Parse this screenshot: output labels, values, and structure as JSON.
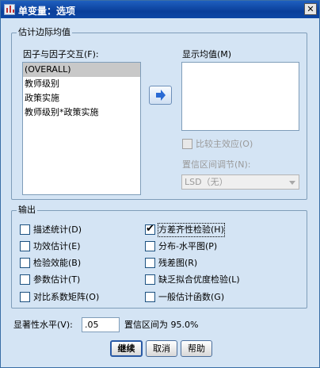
{
  "window": {
    "title": "单变量：选项",
    "close_label": "✕"
  },
  "estimated_marginal_means": {
    "legend": "估计边际均值",
    "factors_label": "因子与因子交互(F):",
    "factors": [
      "(OVERALL)",
      "教师级别",
      "政策实施",
      "教师级别*政策实施"
    ],
    "selected_factor": "(OVERALL)",
    "display_means_label": "显示均值(M)",
    "display_means_items": [],
    "compare_main_effects_label": "比较主效应(O)",
    "compare_main_effects_checked": false,
    "ci_adjustment_label": "置信区间调节(N):",
    "ci_adjustment_value": "LSD（无）"
  },
  "output": {
    "legend": "输出",
    "left_options": [
      {
        "label": "描述统计(D)",
        "checked": false
      },
      {
        "label": "功效估计(E)",
        "checked": false
      },
      {
        "label": "检验效能(B)",
        "checked": false
      },
      {
        "label": "参数估计(T)",
        "checked": false
      },
      {
        "label": "对比系数矩阵(O)",
        "checked": false
      }
    ],
    "right_options": [
      {
        "label": "方差齐性检验(H)",
        "checked": true
      },
      {
        "label": "分布-水平图(P)",
        "checked": false
      },
      {
        "label": "残差图(R)",
        "checked": false
      },
      {
        "label": "缺乏拟合优度检验(L)",
        "checked": false
      },
      {
        "label": "一般估计函数(G)",
        "checked": false
      }
    ]
  },
  "significance": {
    "label": "显著性水平(V):",
    "value": ".05",
    "ci_text": "置信区间为 95.0%"
  },
  "buttons": {
    "continue": "继续",
    "cancel": "取消",
    "help": "帮助"
  },
  "colors": {
    "dialog_bg": "#d4e4f4",
    "titlebar": "#0a3f9a",
    "selection": "#c8c8c8",
    "arrow_button_icon": "#2a6ad4"
  },
  "icons": {
    "title": "spss-chart-icon",
    "move": "arrow-right-icon",
    "check": "checkmark-icon"
  }
}
